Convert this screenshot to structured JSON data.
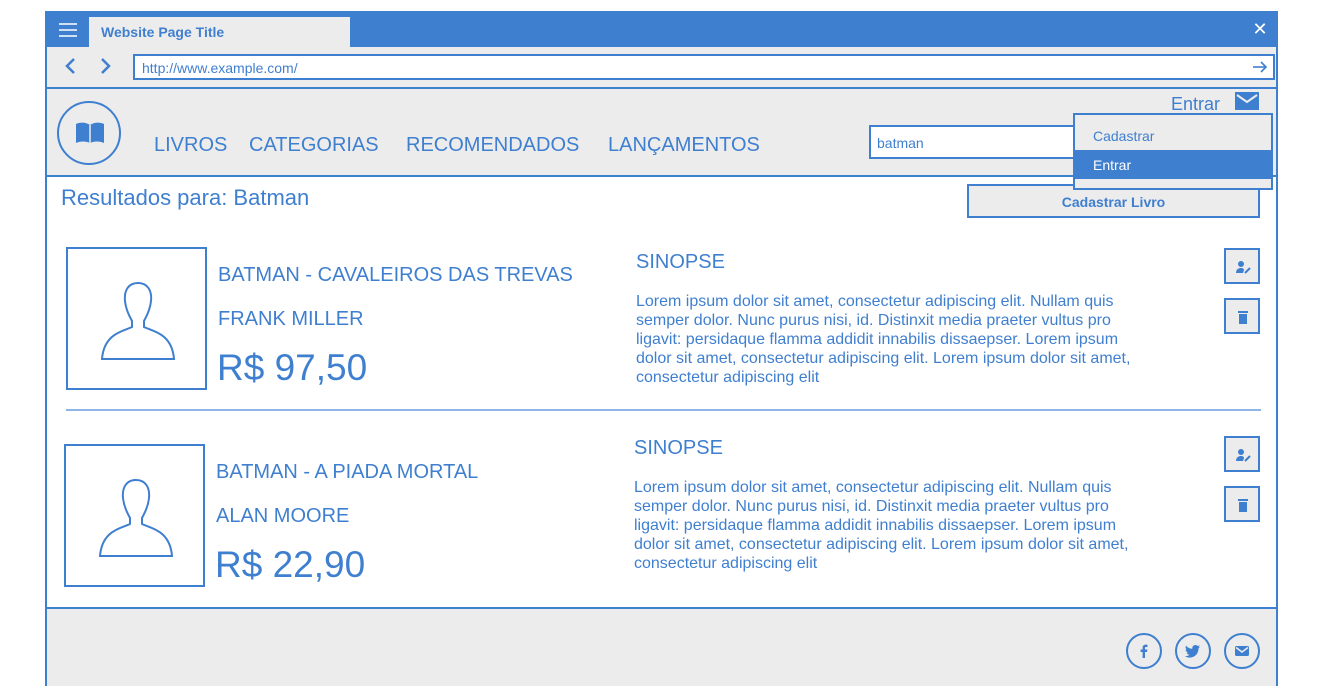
{
  "browser": {
    "tab_title": "Website Page Title",
    "url": "http://www.example.com/",
    "accent_color": "#3f7fd0"
  },
  "header": {
    "nav": [
      "LIVROS",
      "CATEGORIAS",
      "RECOMENDADOS",
      "LANÇAMENTOS"
    ],
    "search_value": "batman",
    "login_label": "Entrar",
    "dropdown": [
      "Cadastrar",
      "Entrar"
    ]
  },
  "results": {
    "title": "Resultados para: Batman",
    "add_book_label": "Cadastrar Livro"
  },
  "books": [
    {
      "title": "BATMAN - CAVALEIROS DAS TREVAS",
      "author": "FRANK MILLER",
      "price": "R$ 97,50",
      "synopsis_heading": "SINOPSE",
      "synopsis": "Lorem ipsum dolor sit amet, consectetur adipiscing elit. Nullam quis semper dolor. Nunc purus nisi, id. Distinxit  media praeter vultus pro ligavit: persidaque flamma addidit innabilis dissaepser. Lorem ipsum dolor sit amet, consectetur adipiscing elit. Lorem ipsum dolor sit amet, consectetur adipiscing elit"
    },
    {
      "title": "BATMAN - A PIADA MORTAL",
      "author": "ALAN MOORE",
      "price": "R$ 22,90",
      "synopsis_heading": "SINOPSE",
      "synopsis": "Lorem ipsum dolor sit amet, consectetur adipiscing elit. Nullam quis semper dolor. Nunc purus nisi, id. Distinxit  media praeter vultus pro ligavit: persidaque flamma addidit innabilis dissaepser. Lorem ipsum dolor sit amet, consectetur adipiscing elit. Lorem ipsum dolor sit amet, consectetur adipiscing elit"
    }
  ],
  "footer": {
    "social_icons": [
      "facebook-icon",
      "twitter-icon",
      "mail-icon"
    ]
  }
}
